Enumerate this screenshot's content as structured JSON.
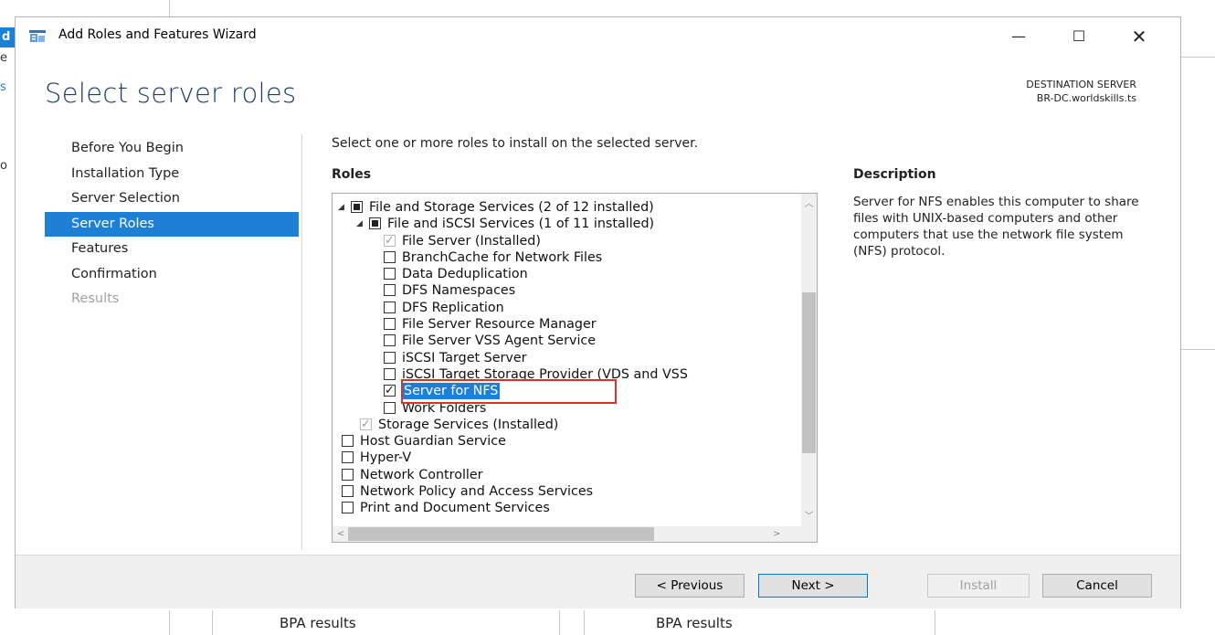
{
  "background": {
    "left_selected_letter": "d",
    "left_fragments": [
      "e",
      "s",
      "o"
    ],
    "bpa_left": "BPA results",
    "bpa_right": "BPA results"
  },
  "window": {
    "title": "Add Roles and Features Wizard",
    "icons": [
      "wizard-icon",
      "minimize-icon",
      "maximize-icon",
      "close-icon"
    ]
  },
  "page": {
    "heading": "Select server roles",
    "destination_label": "DESTINATION SERVER",
    "destination_value": "BR-DC.worldskills.ts",
    "instruction": "Select one or more roles to install on the selected server.",
    "roles_label": "Roles",
    "description_label": "Description",
    "description_text": "Server for NFS enables this computer to share files with UNIX-based computers and other computers that use the network file system (NFS) protocol."
  },
  "nav": [
    {
      "label": "Before You Begin",
      "state": "normal"
    },
    {
      "label": "Installation Type",
      "state": "normal"
    },
    {
      "label": "Server Selection",
      "state": "normal"
    },
    {
      "label": "Server Roles",
      "state": "active"
    },
    {
      "label": "Features",
      "state": "normal"
    },
    {
      "label": "Confirmation",
      "state": "normal"
    },
    {
      "label": "Results",
      "state": "disabled"
    }
  ],
  "roles": [
    {
      "label": "File and Storage Services (2 of 12 installed)",
      "level": 0,
      "expand": true,
      "check": "partial"
    },
    {
      "label": "File and iSCSI Services (1 of 11 installed)",
      "level": 1,
      "expand": true,
      "check": "partial"
    },
    {
      "label": "File Server (Installed)",
      "level": 2,
      "check": "grey"
    },
    {
      "label": "BranchCache for Network Files",
      "level": 2,
      "check": "none"
    },
    {
      "label": "Data Deduplication",
      "level": 2,
      "check": "none"
    },
    {
      "label": "DFS Namespaces",
      "level": 2,
      "check": "none"
    },
    {
      "label": "DFS Replication",
      "level": 2,
      "check": "none"
    },
    {
      "label": "File Server Resource Manager",
      "level": 2,
      "check": "none"
    },
    {
      "label": "File Server VSS Agent Service",
      "level": 2,
      "check": "none"
    },
    {
      "label": "iSCSI Target Server",
      "level": 2,
      "check": "none"
    },
    {
      "label": "iSCSI Target Storage Provider (VDS and VSS",
      "level": 2,
      "check": "none"
    },
    {
      "label": "Server for NFS",
      "level": 2,
      "check": "checked",
      "selected": true
    },
    {
      "label": "Work Folders",
      "level": 2,
      "check": "none"
    },
    {
      "label": "Storage Services (Installed)",
      "level": 1,
      "check": "grey"
    },
    {
      "label": "Host Guardian Service",
      "level": 0,
      "check": "none"
    },
    {
      "label": "Hyper-V",
      "level": 0,
      "check": "none"
    },
    {
      "label": "Network Controller",
      "level": 0,
      "check": "none"
    },
    {
      "label": "Network Policy and Access Services",
      "level": 0,
      "check": "none"
    },
    {
      "label": "Print and Document Services",
      "level": 0,
      "check": "none"
    }
  ],
  "buttons": {
    "previous": "< Previous",
    "next": "Next >",
    "install": "Install",
    "cancel": "Cancel"
  },
  "colors": {
    "accent": "#1e7fd6",
    "heading": "#1f3d63",
    "highlight_box": "#d9342b"
  }
}
